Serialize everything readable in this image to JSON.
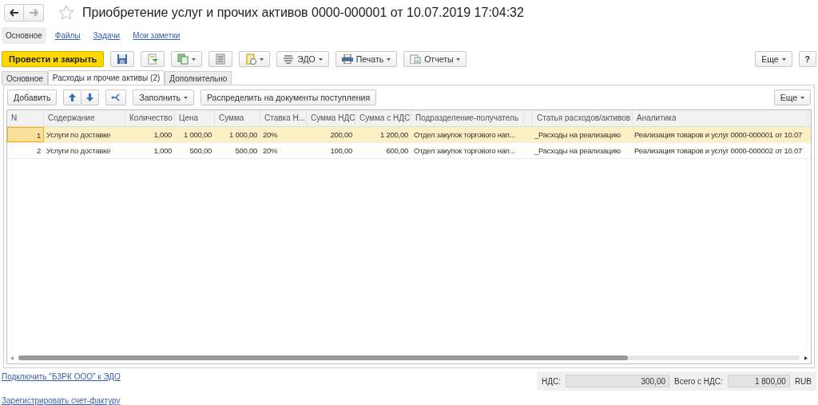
{
  "window": {
    "title": "Приобретение услуг и прочих активов 0000-000001 от 10.07.2019 17:04:32",
    "favorite": false
  },
  "nav_links": [
    {
      "label": "Основное",
      "selected": true
    },
    {
      "label": "Файлы",
      "selected": false
    },
    {
      "label": "Задачи",
      "selected": false
    },
    {
      "label": "Мои заметки",
      "selected": false
    }
  ],
  "toolbar": {
    "primary": "Провести и закрыть",
    "buttons": [
      {
        "kind": "save"
      },
      {
        "kind": "post"
      },
      {
        "kind": "copy"
      },
      {
        "kind": "list"
      },
      {
        "kind": "docs"
      },
      {
        "kind": "edo",
        "label": "ЭДО"
      },
      {
        "kind": "print",
        "label": "Печать"
      },
      {
        "kind": "report",
        "label": "Отчеты"
      }
    ],
    "more": "Еще",
    "help": "?"
  },
  "tabs": [
    {
      "label": "Основное",
      "selected": false
    },
    {
      "label": "Расходы и прочие активы (2)",
      "selected": true
    },
    {
      "label": "Дополнительно",
      "selected": false
    }
  ],
  "table_toolbar": {
    "add": "Добавить",
    "fill": "Заполнить",
    "distribute": "Распределить на документы поступления",
    "more": "Еще"
  },
  "table": {
    "columns": [
      "N",
      "Содержание",
      "Количество",
      "Цена",
      "Сумма",
      "Ставка Н...",
      "Сумма НДС",
      "Сумма с НДС",
      "Подразделение-получатель",
      "",
      "Статья расходов/активов",
      "Аналитика"
    ],
    "rows": [
      {
        "selected": true,
        "cells": [
          "1",
          "Услуги по доставке",
          "1,000",
          "1 000,00",
          "1 000,00",
          "20%",
          "200,00",
          "1 200,00",
          "Отдел закупок торгового нап...",
          "",
          "_Расходы на реализацию",
          "Реализация товаров и услуг 0000-000001 от 10.07"
        ]
      },
      {
        "selected": false,
        "cells": [
          "2",
          "Услуги по доставке",
          "1,000",
          "500,00",
          "500,00",
          "20%",
          "100,00",
          "600,00",
          "Отдел закупок торгового нап...",
          "",
          "_Расходы на реализацию",
          "Реализация товаров и услуг 0000-000002 от 10.07"
        ]
      }
    ]
  },
  "footer": {
    "links": [
      "Подключить \"БЗРК ООО\" к ЭДО",
      "Зарегистрировать счет-фактуру"
    ],
    "vat_label": "НДС:",
    "vat": "300,00",
    "total_label": "Всего с НДС:",
    "total": "1 800,00",
    "currency": "RUB"
  }
}
